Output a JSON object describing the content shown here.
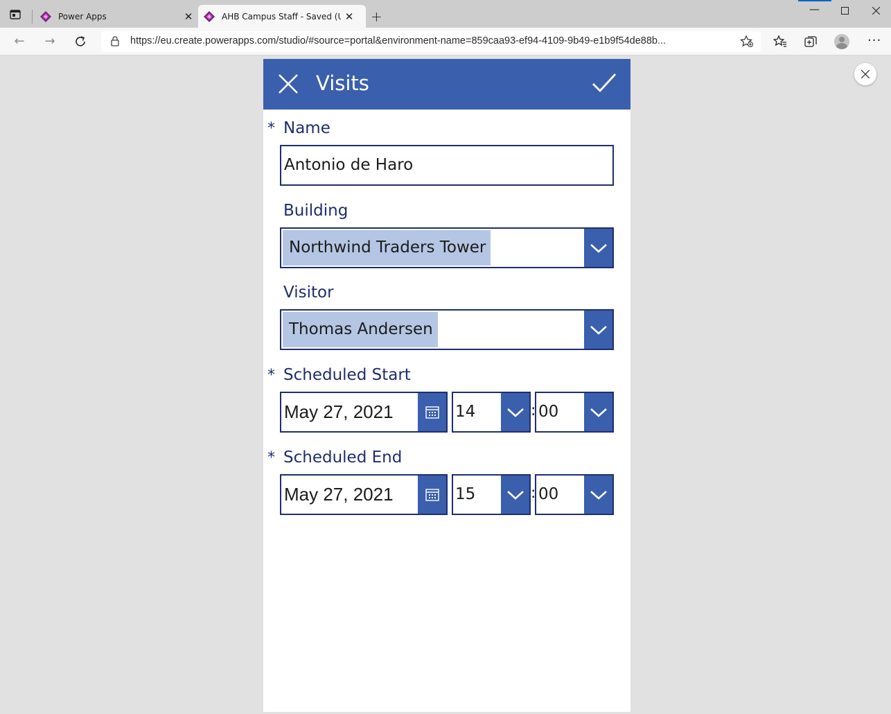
{
  "browser": {
    "tabs": [
      {
        "title": "Power Apps",
        "active": false
      },
      {
        "title": "AHB Campus Staff - Saved (Unpublished)",
        "active": true
      }
    ],
    "url": "https://eu.create.powerapps.com/studio/#source=portal&environment-name=859caa93-ef94-4109-9b49-e1b9f54de88b...",
    "accent_color": "#0a63c9"
  },
  "app": {
    "header": {
      "title": "Visits",
      "cancel_icon": "close-icon",
      "submit_icon": "checkmark-icon",
      "color": "#3a5fad"
    },
    "fields": {
      "name": {
        "label": "Name",
        "required_marker": "*",
        "value": "Antonio de Haro"
      },
      "building": {
        "label": "Building",
        "selected": "Northwind Traders Tower"
      },
      "visitor": {
        "label": "Visitor",
        "selected": "Thomas Andersen"
      },
      "scheduled_start": {
        "label": "Scheduled Start",
        "required_marker": "*",
        "date": "May 27, 2021",
        "hour": "14",
        "minute": "00",
        "separator": ":"
      },
      "scheduled_end": {
        "label": "Scheduled End",
        "required_marker": "*",
        "date": "May 27, 2021",
        "hour": "15",
        "minute": "00",
        "separator": ":"
      }
    },
    "label_color": "#1f2d6e",
    "selection_color": "#b5c6e4"
  }
}
